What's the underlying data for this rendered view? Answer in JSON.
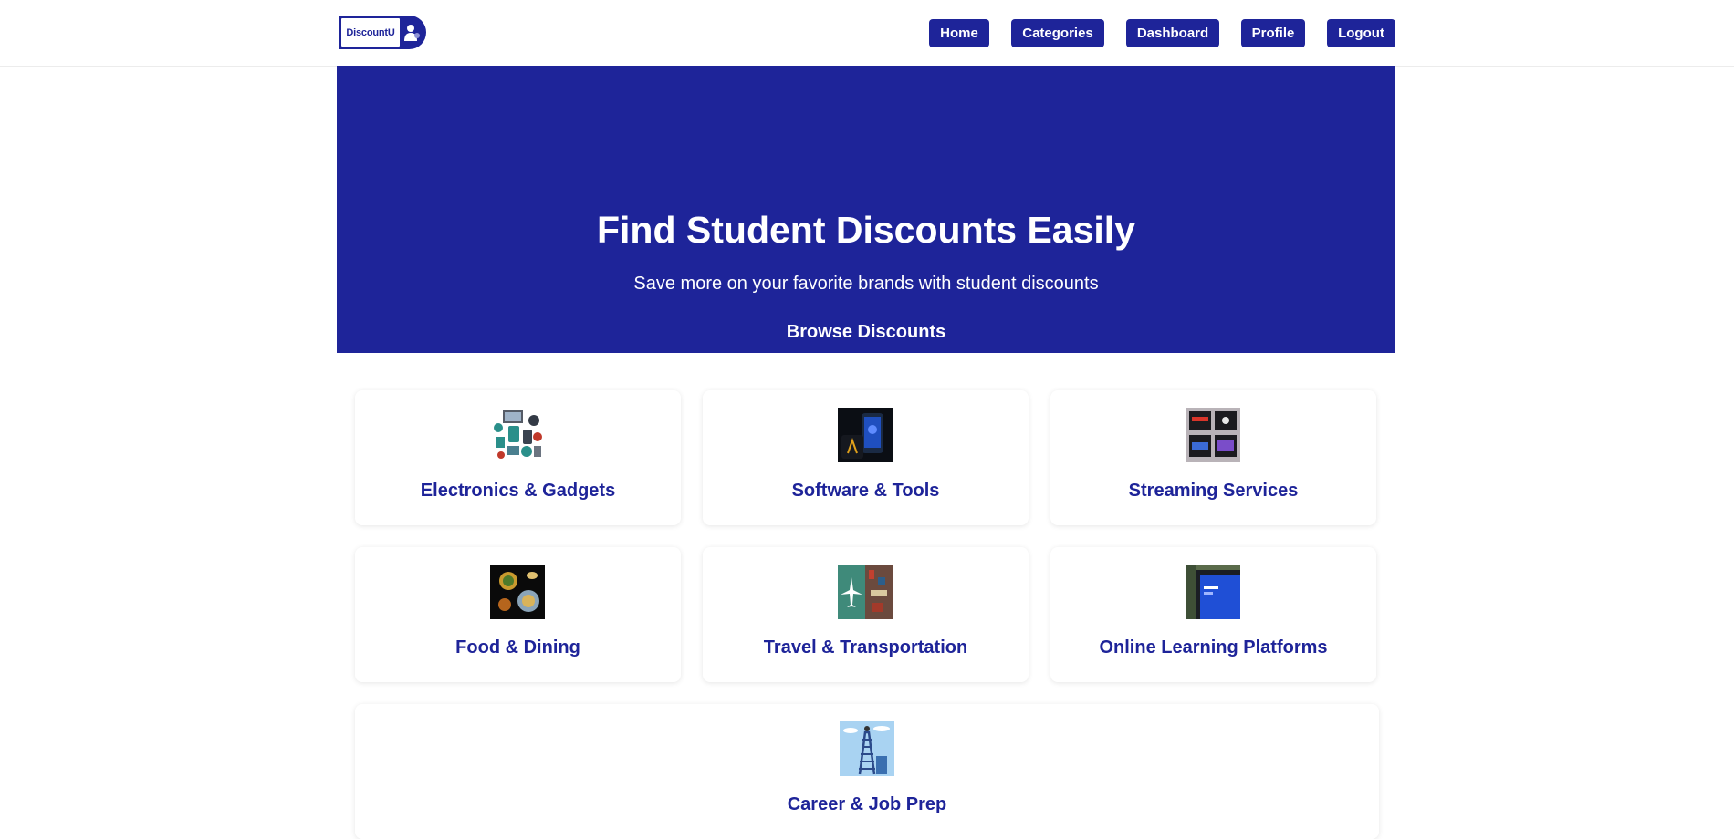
{
  "brand": {
    "logo_text": "DiscountU"
  },
  "nav": {
    "items": [
      {
        "label": "Home"
      },
      {
        "label": "Categories"
      },
      {
        "label": "Dashboard"
      },
      {
        "label": "Profile"
      },
      {
        "label": "Logout"
      }
    ]
  },
  "hero": {
    "title": "Find Student Discounts Easily",
    "subtitle": "Save more on your favorite brands with student discounts",
    "cta": "Browse Discounts"
  },
  "categories": [
    {
      "title": "Electronics & Gadgets",
      "icon": "electronics-image"
    },
    {
      "title": "Software & Tools",
      "icon": "software-image"
    },
    {
      "title": "Streaming Services",
      "icon": "streaming-image"
    },
    {
      "title": "Food & Dining",
      "icon": "food-image"
    },
    {
      "title": "Travel & Transportation",
      "icon": "travel-image"
    },
    {
      "title": "Online Learning Platforms",
      "icon": "learning-image"
    },
    {
      "title": "Career & Job Prep",
      "icon": "career-image"
    }
  ],
  "colors": {
    "primary": "#1e2499",
    "background": "#ffffff",
    "text_on_primary": "#ffffff"
  }
}
